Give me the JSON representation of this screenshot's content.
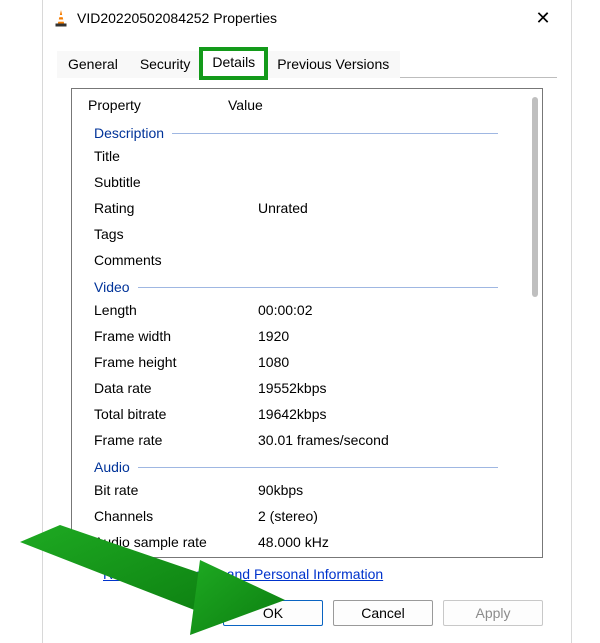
{
  "window": {
    "title": "VID20220502084252 Properties",
    "close_glyph": "✕"
  },
  "tabs": {
    "t0": "General",
    "t1": "Security",
    "t2": "Details",
    "t3": "Previous Versions"
  },
  "header": {
    "property": "Property",
    "value": "Value"
  },
  "groups": {
    "description": {
      "title": "Description",
      "fields": {
        "title_label": "Title",
        "title_value": "",
        "subtitle_label": "Subtitle",
        "subtitle_value": "",
        "rating_label": "Rating",
        "rating_value": "Unrated",
        "tags_label": "Tags",
        "tags_value": "",
        "comments_label": "Comments",
        "comments_value": ""
      }
    },
    "video": {
      "title": "Video",
      "fields": {
        "length_label": "Length",
        "length_value": "00:00:02",
        "fw_label": "Frame width",
        "fw_value": "1920",
        "fh_label": "Frame height",
        "fh_value": "1080",
        "dr_label": "Data rate",
        "dr_value": "19552kbps",
        "tb_label": "Total bitrate",
        "tb_value": "19642kbps",
        "fr_label": "Frame rate",
        "fr_value": "30.01 frames/second"
      }
    },
    "audio": {
      "title": "Audio",
      "fields": {
        "br_label": "Bit rate",
        "br_value": "90kbps",
        "ch_label": "Channels",
        "ch_value": "2 (stereo)",
        "sr_label": "Audio sample rate",
        "sr_value": "48.000 kHz"
      }
    }
  },
  "link_text": "Remove Properties and Personal Information",
  "buttons": {
    "ok": "OK",
    "cancel": "Cancel",
    "apply": "Apply"
  },
  "highlight": {
    "active_tab": "Details",
    "ok_highlight": true
  }
}
